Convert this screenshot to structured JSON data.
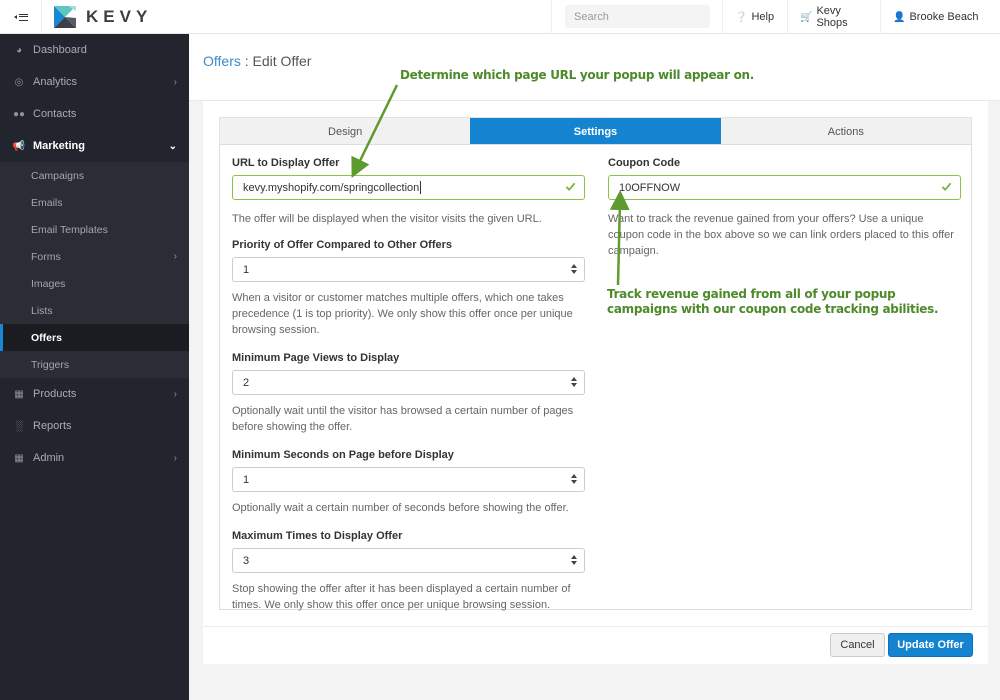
{
  "topbar": {
    "brand": "KEVY",
    "search_placeholder": "Search",
    "help_label": "Help",
    "shops_label": "Kevy Shops",
    "user_label": "Brooke Beach",
    "logo_colors": {
      "teal": "#5ec6c0",
      "blue": "#1a87d4",
      "dark": "#3a3f48"
    }
  },
  "sidebar": {
    "items": [
      {
        "label": "Dashboard",
        "icon": "dashboard-icon"
      },
      {
        "label": "Analytics",
        "icon": "analytics-icon",
        "has_children": true
      },
      {
        "label": "Contacts",
        "icon": "contacts-icon"
      },
      {
        "label": "Marketing",
        "icon": "megaphone-icon",
        "expanded": true,
        "children": [
          {
            "label": "Campaigns"
          },
          {
            "label": "Emails"
          },
          {
            "label": "Email Templates"
          },
          {
            "label": "Forms",
            "has_children": true
          },
          {
            "label": "Images"
          },
          {
            "label": "Lists"
          },
          {
            "label": "Offers",
            "active": true
          },
          {
            "label": "Triggers"
          }
        ]
      },
      {
        "label": "Products",
        "icon": "table-icon",
        "has_children": true
      },
      {
        "label": "Reports",
        "icon": "bar-chart-icon"
      },
      {
        "label": "Admin",
        "icon": "grid-icon",
        "has_children": true
      }
    ]
  },
  "header": {
    "breadcrumb_link": "Offers",
    "separator": " : ",
    "title": "Edit Offer"
  },
  "annotations": {
    "url_note": "Determine which page URL your popup will appear on.",
    "coupon_note": "Track revenue gained from all of your popup campaigns with our coupon code tracking abilities.",
    "color": "#4e8a2a"
  },
  "tabs": [
    {
      "label": "Design",
      "active": false
    },
    {
      "label": "Settings",
      "active": true
    },
    {
      "label": "Actions",
      "active": false
    }
  ],
  "form": {
    "url": {
      "label": "URL to Display Offer",
      "value": "kevy.myshopify.com/springcollection",
      "help": "The offer will be displayed when the visitor visits the given URL."
    },
    "priority": {
      "label": "Priority of Offer Compared to Other Offers",
      "value": "1",
      "help": "When a visitor or customer matches multiple offers, which one takes precedence (1 is top priority). We only show this offer once per unique browsing session."
    },
    "min_page_views": {
      "label": "Minimum Page Views to Display",
      "value": "2",
      "help": "Optionally wait until the visitor has browsed a certain number of pages before showing the offer."
    },
    "min_seconds": {
      "label": "Minimum Seconds on Page before Display",
      "value": "1",
      "help": "Optionally wait a certain number of seconds before showing the offer."
    },
    "max_times": {
      "label": "Maximum Times to Display Offer",
      "value": "3",
      "help": "Stop showing the offer after it has been displayed a certain number of times. We only show this offer once per unique browsing session."
    },
    "coupon": {
      "label": "Coupon Code",
      "value": "10OFFNOW",
      "help": "Want to track the revenue gained from your offers? Use a unique coupon code in the box above so we can link orders placed to this offer campaign."
    }
  },
  "actions": {
    "cancel_label": "Cancel",
    "update_label": "Update Offer"
  },
  "colors": {
    "accent": "#1584d0",
    "sidebar_bg": "#22252d",
    "valid_border": "#8bc34a"
  }
}
